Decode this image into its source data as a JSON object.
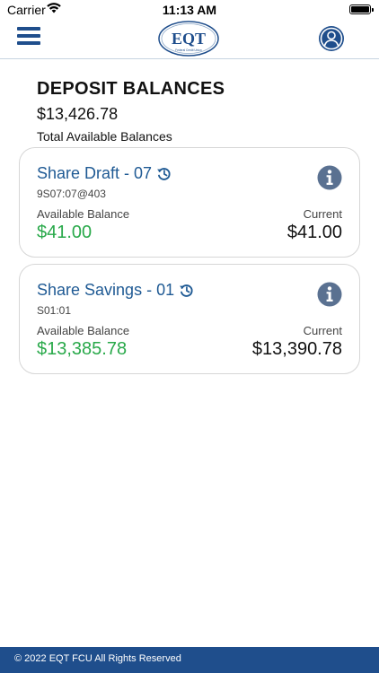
{
  "status_bar": {
    "carrier": "Carrier",
    "time": "11:13 AM"
  },
  "header": {
    "logo_text": "EQT",
    "logo_subtext": "Federal Credit Union"
  },
  "summary": {
    "title": "DEPOSIT BALANCES",
    "total": "$13,426.78",
    "label": "Total Available Balances"
  },
  "accounts": [
    {
      "name": "Share Draft - 07",
      "number": "9S07:07@403",
      "available_label": "Available Balance",
      "available_value": "$41.00",
      "current_label": "Current",
      "current_value": "$41.00"
    },
    {
      "name": "Share Savings - 01",
      "number": "S01:01",
      "available_label": "Available Balance",
      "available_value": "$13,385.78",
      "current_label": "Current",
      "current_value": "$13,390.78"
    }
  ],
  "footer": {
    "text": "© 2022 EQT FCU All Rights Reserved"
  },
  "colors": {
    "brand_blue": "#1f4e8c",
    "link_blue": "#1f5a94",
    "available_green": "#29a94a",
    "info_gray_blue": "#5a7191"
  }
}
